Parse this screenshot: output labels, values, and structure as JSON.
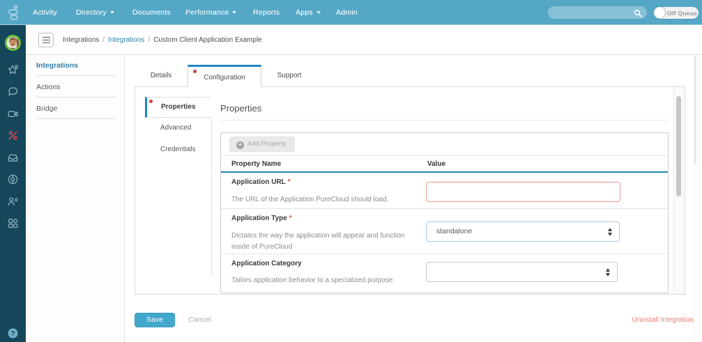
{
  "topbar": {
    "nav": [
      {
        "label": "Activity",
        "dropdown": false
      },
      {
        "label": "Directory",
        "dropdown": true
      },
      {
        "label": "Documents",
        "dropdown": false
      },
      {
        "label": "Performance",
        "dropdown": true
      },
      {
        "label": "Reports",
        "dropdown": false
      },
      {
        "label": "Apps",
        "dropdown": true
      },
      {
        "label": "Admin",
        "dropdown": false
      }
    ],
    "search": {
      "value": "",
      "placeholder": ""
    },
    "presence_toggle": {
      "label": "Off Queue",
      "state": "off"
    }
  },
  "rail": {
    "avatar": "user-avatar",
    "icons": [
      "star",
      "chat",
      "video",
      "phone-disabled",
      "inbox",
      "relate",
      "person-speaking",
      "org-blocks"
    ],
    "help": "?"
  },
  "breadcrumb": {
    "separator": "/",
    "items": [
      {
        "label": "Integrations",
        "link": false
      },
      {
        "label": "Integrations",
        "link": true
      },
      {
        "label": "Custom Client Application Example",
        "link": false
      }
    ]
  },
  "subnav": {
    "items": [
      {
        "label": "Integrations",
        "active": true
      },
      {
        "label": "Actions",
        "active": false
      },
      {
        "label": "Bridge",
        "active": false
      }
    ]
  },
  "tabs": {
    "items": [
      {
        "label": "Details",
        "active": false,
        "dirty": false
      },
      {
        "label": "Configuration",
        "active": true,
        "dirty": true
      },
      {
        "label": "Support",
        "active": false,
        "dirty": false
      }
    ]
  },
  "config_tabs": {
    "items": [
      {
        "label": "Properties",
        "active": true,
        "dirty": true
      },
      {
        "label": "Advanced",
        "active": false
      },
      {
        "label": "Credentials",
        "active": false
      }
    ]
  },
  "properties_panel": {
    "heading": "Properties",
    "add_button": {
      "label": "Add Property",
      "disabled": true,
      "icon": "plus-circle-icon",
      "plus_glyph": "+"
    },
    "required_marker": "*",
    "table": {
      "columns": [
        "Property Name",
        "Value"
      ],
      "rows": [
        {
          "name": "Application URL",
          "required": true,
          "description": "The URL of the Application PureCloud should load.",
          "control": "text-input",
          "value": "",
          "state": "error"
        },
        {
          "name": "Application Type",
          "required": true,
          "description": "Dictates the way the application will appear and function inside of PureCloud",
          "control": "select",
          "value": "standalone",
          "state": "focus"
        },
        {
          "name": "Application Category",
          "required": false,
          "description": "Tailors application behavior to a specialized purpose.",
          "control": "select",
          "value": "",
          "state": "normal"
        }
      ]
    }
  },
  "footer": {
    "save": "Save",
    "cancel": "Cancel",
    "uninstall": "Uninstall Integration"
  },
  "colors": {
    "topbar": "#55a7c6",
    "rail": "#164659",
    "accent_blue": "#1f86be",
    "link_blue": "#2e7fa7",
    "dirty_dot": "#ca4a42",
    "error_border": "#e89b92",
    "save_button": "#41a7cb",
    "uninstall_text": "#f2796d",
    "avatar_ring": "#6ccd37"
  }
}
